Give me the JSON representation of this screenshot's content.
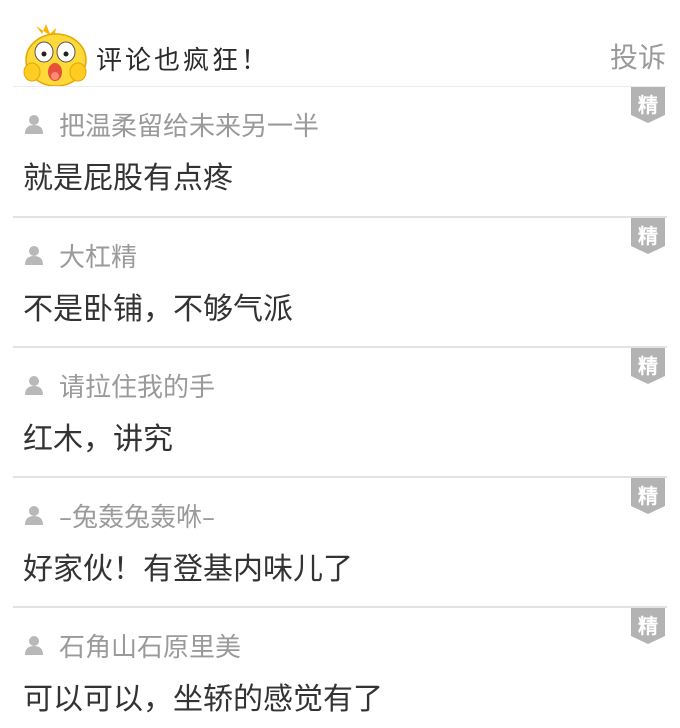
{
  "header": {
    "title": "评论也疯狂！",
    "report_label": "投诉"
  },
  "comments": [
    {
      "author": "把温柔留给未来另一半",
      "text": "就是屁股有点疼",
      "badge": "精"
    },
    {
      "author": "大杠精",
      "text": "不是卧铺，不够气派",
      "badge": "精"
    },
    {
      "author": "请拉住我的手",
      "text": "红木，讲究",
      "badge": "精"
    },
    {
      "author": "–兔轰兔轰咻–",
      "text": "好家伙！有登基内味儿了",
      "badge": "精"
    },
    {
      "author": "石角山石原里美",
      "text": "可以可以，坐轿的感觉有了",
      "badge": "精"
    }
  ],
  "colors": {
    "accent_badge": "#b3b3b3",
    "muted_text": "#9a9a9a",
    "body_text": "#333333",
    "mascot_yellow": "#ffd83a"
  },
  "icons": {
    "mascot": "yellow-chick-mascot-icon",
    "user": "user-icon",
    "badge": "featured-badge-icon"
  }
}
